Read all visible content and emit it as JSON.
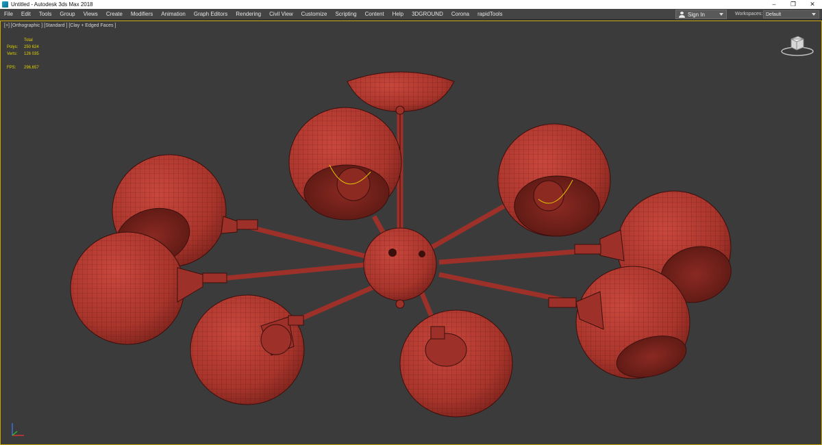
{
  "window": {
    "title": "Untitled - Autodesk 3ds Max 2018",
    "controls": {
      "minimize": "–",
      "restore": "❐",
      "close": "✕"
    }
  },
  "menu": {
    "items": [
      "File",
      "Edit",
      "Tools",
      "Group",
      "Views",
      "Create",
      "Modifiers",
      "Animation",
      "Graph Editors",
      "Rendering",
      "Civil View",
      "Customize",
      "Scripting",
      "Content",
      "Help",
      "3DGROUND",
      "Corona",
      "rapidTools"
    ],
    "sign_in": "Sign In",
    "workspaces_label": "Workspaces:",
    "workspace_value": "Default"
  },
  "viewport": {
    "label": "[+] [Orthographic ] [Standard ] [Clay + Edged Faces ]",
    "stats": {
      "header": "Total",
      "polys_label": "Polys:",
      "polys_value": "250 624",
      "verts_label": "Verts:",
      "verts_value": "126 035",
      "fps_label": "FPS:",
      "fps_value": "296,657"
    }
  },
  "colors": {
    "model_fill": "#b23a30",
    "wire": "#3a0f0c",
    "selection_border": "#c8a800",
    "viewport_bg": "#3b3b3b"
  },
  "icons": [
    "app-icon",
    "user-icon",
    "dropdown-caret-icon",
    "viewcube-icon",
    "axis-gizmo-icon"
  ]
}
